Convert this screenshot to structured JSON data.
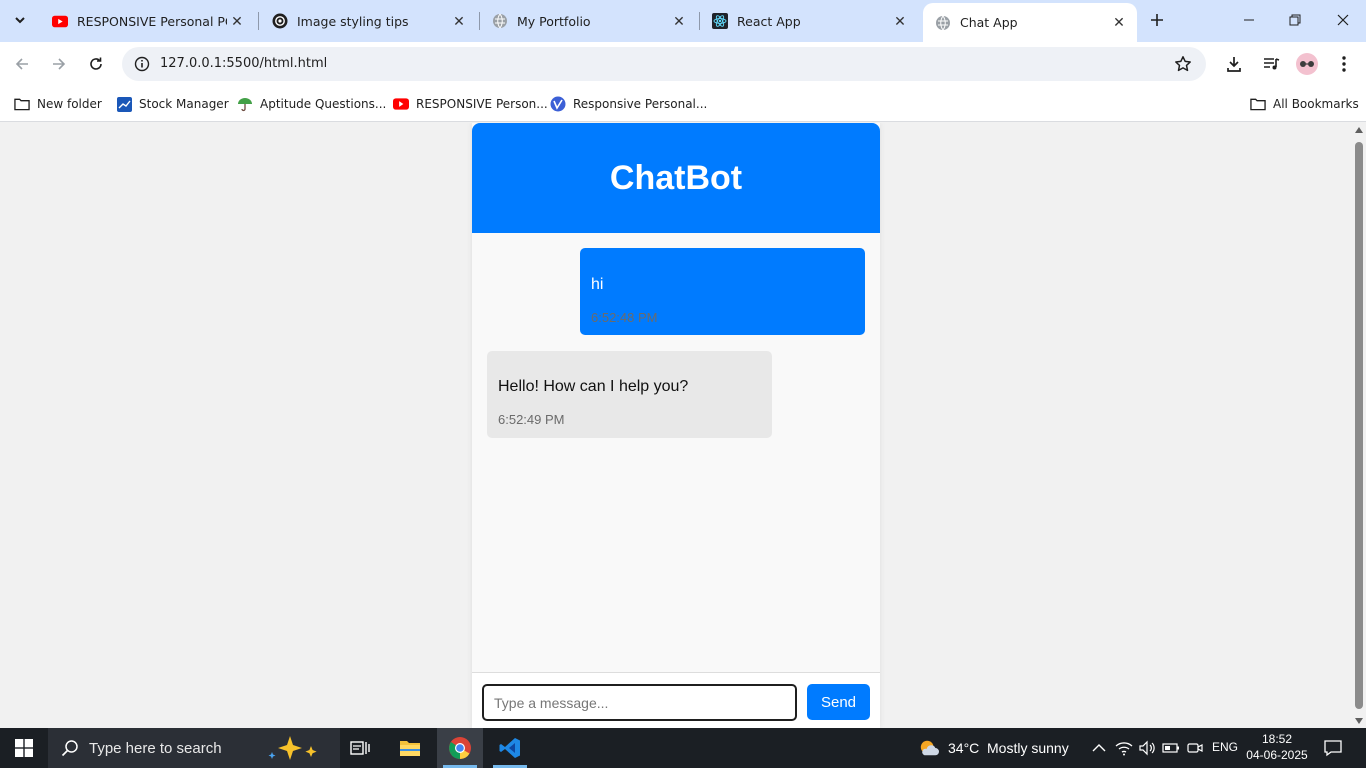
{
  "browser": {
    "tabs": [
      {
        "title": "RESPONSIVE Personal PORTF",
        "favicon": "youtube-icon"
      },
      {
        "title": "Image styling tips",
        "favicon": "openai-icon"
      },
      {
        "title": "My Portfolio",
        "favicon": "globe-icon"
      },
      {
        "title": "React App",
        "favicon": "react-icon"
      },
      {
        "title": "Chat App",
        "favicon": "globe-icon",
        "active": true
      }
    ],
    "url": "127.0.0.1:5500/html.html",
    "bookmarks": [
      {
        "label": "New folder",
        "icon": "folder-icon"
      },
      {
        "label": "Stock Manager",
        "icon": "chart-icon"
      },
      {
        "label": "Aptitude Questions...",
        "icon": "umbrella-icon"
      },
      {
        "label": "RESPONSIVE Person...",
        "icon": "youtube-icon"
      },
      {
        "label": "Responsive Personal...",
        "icon": "site-icon"
      }
    ],
    "all_bookmarks": "All Bookmarks"
  },
  "chat": {
    "title": "ChatBot",
    "accent_color": "#007bff",
    "messages": [
      {
        "sender": "user",
        "text": "hi",
        "time": "6:52:48 PM"
      },
      {
        "sender": "bot",
        "text": "Hello! How can I help you?",
        "time": "6:52:49 PM"
      }
    ],
    "input": {
      "placeholder": "Type a message...",
      "value": ""
    },
    "send_label": "Send"
  },
  "taskbar": {
    "search_placeholder": "Type here to search",
    "weather": {
      "temp": "34°C",
      "condition": "Mostly sunny"
    },
    "language": "ENG",
    "time": "18:52",
    "date": "04-06-2025"
  }
}
